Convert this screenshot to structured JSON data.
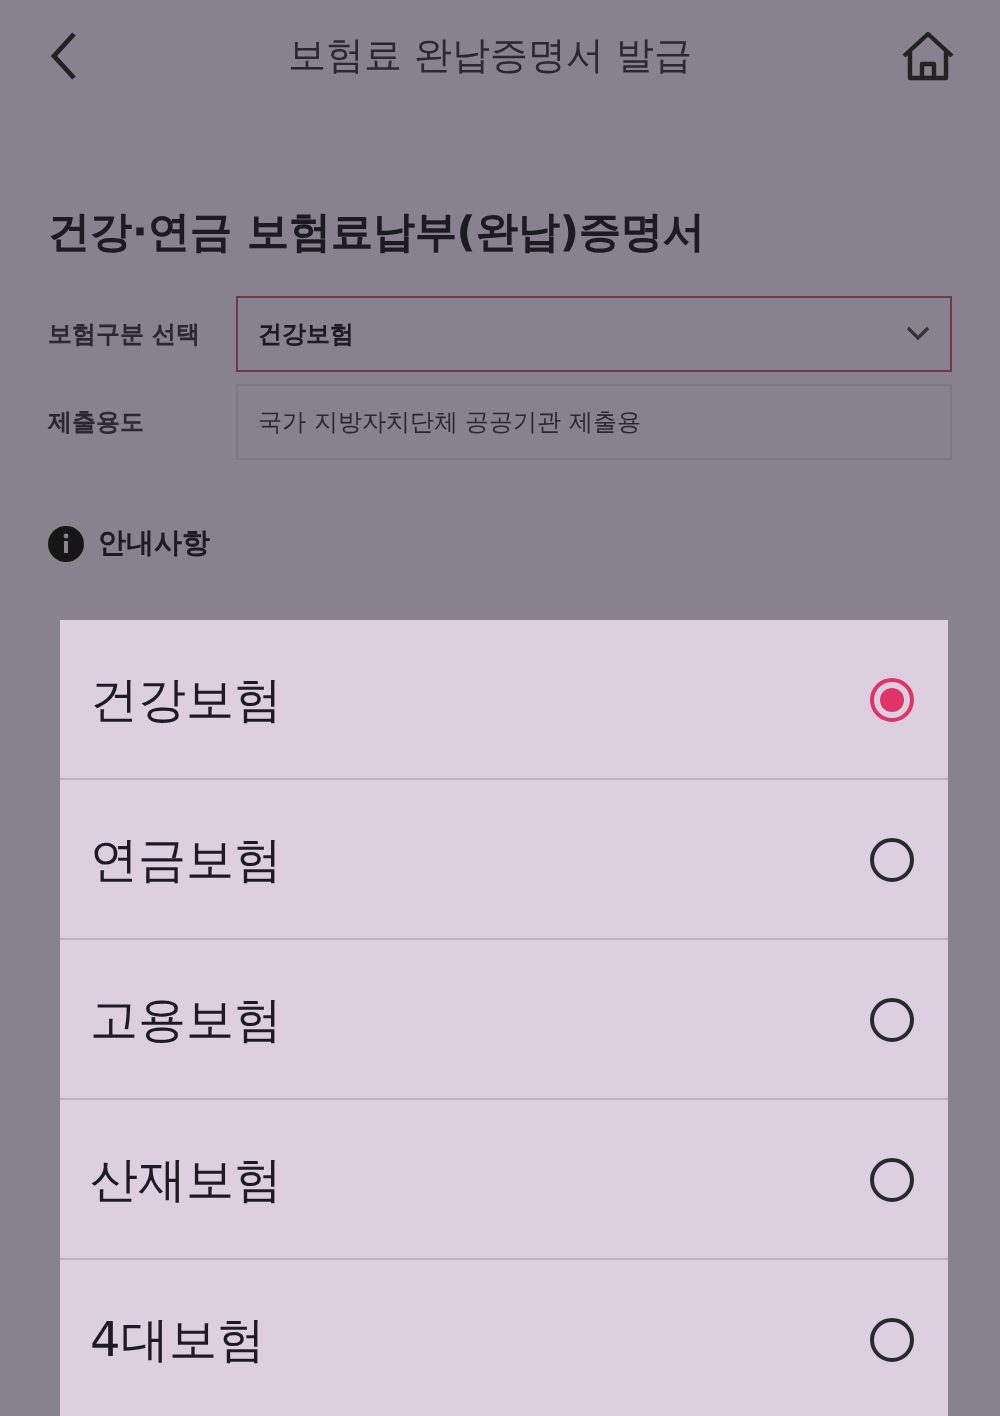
{
  "header": {
    "title": "보험료 완납증명서 발급"
  },
  "page_title": "건강·연금 보험료납부(완납)증명서",
  "form": [
    {
      "kind": "select",
      "label": "보험구분 선택",
      "value": "건강보험"
    },
    {
      "kind": "readonly",
      "label": "제출용도",
      "value": "국가 지방자치단체 공공기관 제출용"
    }
  ],
  "notice": {
    "title": "안내사항"
  },
  "options": [
    {
      "label": "건강보험",
      "selected": true
    },
    {
      "label": "연금보험",
      "selected": false
    },
    {
      "label": "고용보험",
      "selected": false
    },
    {
      "label": "산재보험",
      "selected": false
    },
    {
      "label": "4대보험",
      "selected": false
    }
  ]
}
